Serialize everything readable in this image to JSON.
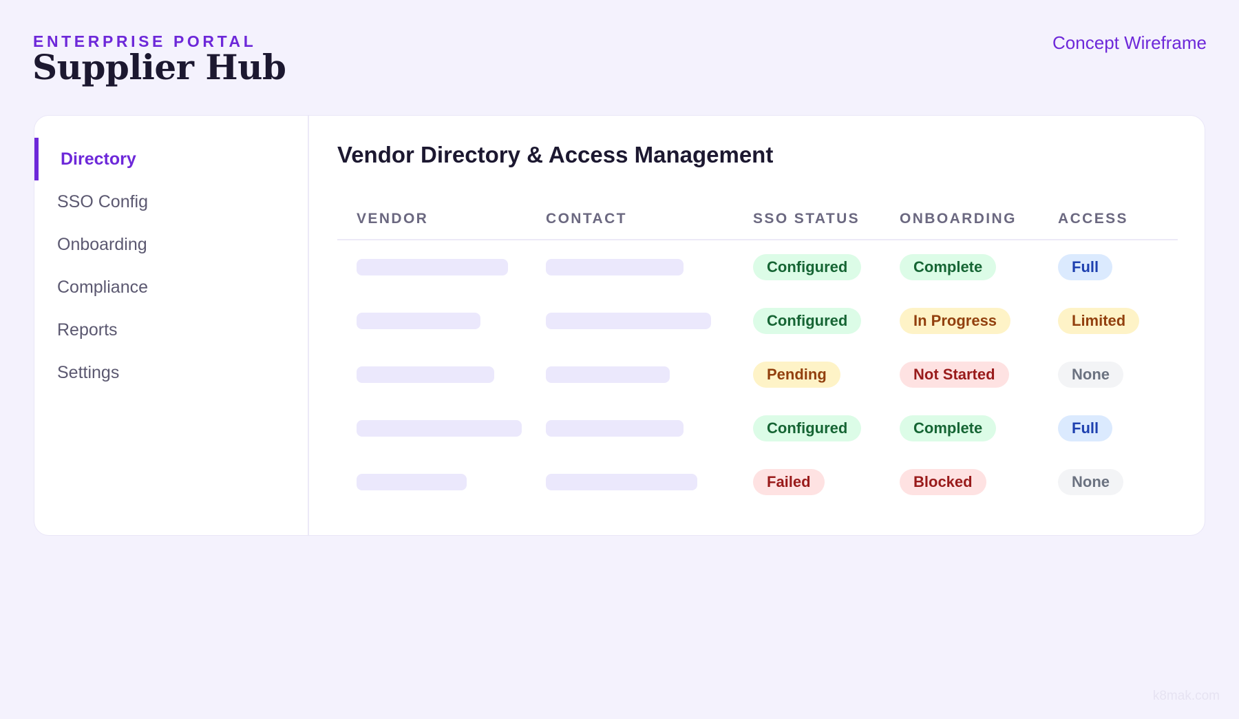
{
  "header": {
    "eyebrow": "ENTERPRISE PORTAL",
    "title": "Supplier Hub",
    "link": "Concept Wireframe"
  },
  "sidebar": {
    "items": [
      {
        "label": "Directory",
        "active": true
      },
      {
        "label": "SSO Config",
        "active": false
      },
      {
        "label": "Onboarding",
        "active": false
      },
      {
        "label": "Compliance",
        "active": false
      },
      {
        "label": "Reports",
        "active": false
      },
      {
        "label": "Settings",
        "active": false
      }
    ]
  },
  "main": {
    "title": "Vendor Directory & Access Management",
    "columns": [
      "VENDOR",
      "CONTACT",
      "SSO STATUS",
      "ONBOARDING",
      "ACCESS"
    ],
    "rows": [
      {
        "sso": "Configured",
        "onboarding": "Complete",
        "access": "Full"
      },
      {
        "sso": "Configured",
        "onboarding": "In Progress",
        "access": "Limited"
      },
      {
        "sso": "Pending",
        "onboarding": "Not Started",
        "access": "None"
      },
      {
        "sso": "Configured",
        "onboarding": "Complete",
        "access": "Full"
      },
      {
        "sso": "Failed",
        "onboarding": "Blocked",
        "access": "None"
      }
    ]
  },
  "status_colors": {
    "green_bg": "#dcfce7",
    "green_text": "#166534",
    "yellow_bg": "#fef3c7",
    "yellow_text": "#92400e",
    "red_bg": "#fee2e2",
    "red_text": "#991b1b",
    "blue_bg": "#dbeafe",
    "blue_text": "#1e40af",
    "gray_bg": "#f3f4f6",
    "gray_text": "#6b7280",
    "accent": "#6d28d9"
  },
  "watermark": "k8mak.com"
}
